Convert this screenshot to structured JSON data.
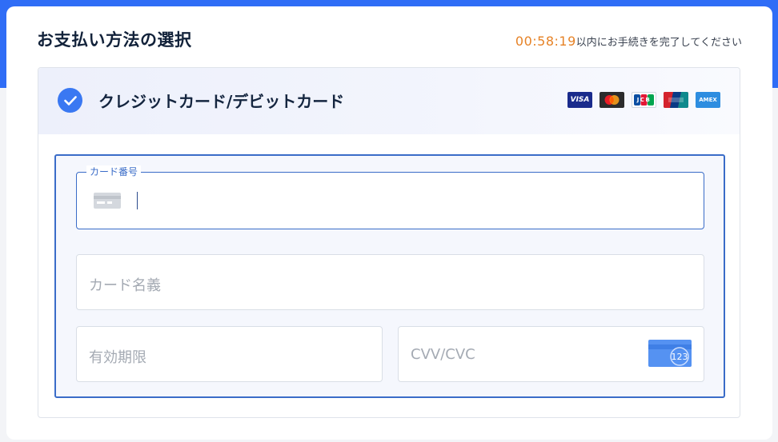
{
  "header": {
    "title": "お支払い方法の選択",
    "timer": {
      "count": "00:58:19",
      "suffix": "以内にお手続きを完了してください"
    }
  },
  "payment_method": {
    "label": "クレジットカード/デビットカード",
    "selected": true,
    "brands": [
      {
        "name": "visa",
        "text": "VISA"
      },
      {
        "name": "mastercard"
      },
      {
        "name": "jcb",
        "text": "JCB"
      },
      {
        "name": "unionpay"
      },
      {
        "name": "amex",
        "text": "AMEX"
      }
    ]
  },
  "form": {
    "card_number": {
      "label": "カード番号",
      "value": "",
      "icon": "credit-card-icon"
    },
    "card_name": {
      "placeholder": "カード名義",
      "value": ""
    },
    "expiry": {
      "placeholder": "有効期限",
      "value": ""
    },
    "cvv": {
      "placeholder": "CVV/CVC",
      "value": "",
      "icon": "cvv-card-icon",
      "icon_text": "123"
    }
  },
  "colors": {
    "accent": "#2f6df6",
    "timer": "#e68226",
    "active_border": "#3a6cc8",
    "check": "#3a78f2"
  }
}
